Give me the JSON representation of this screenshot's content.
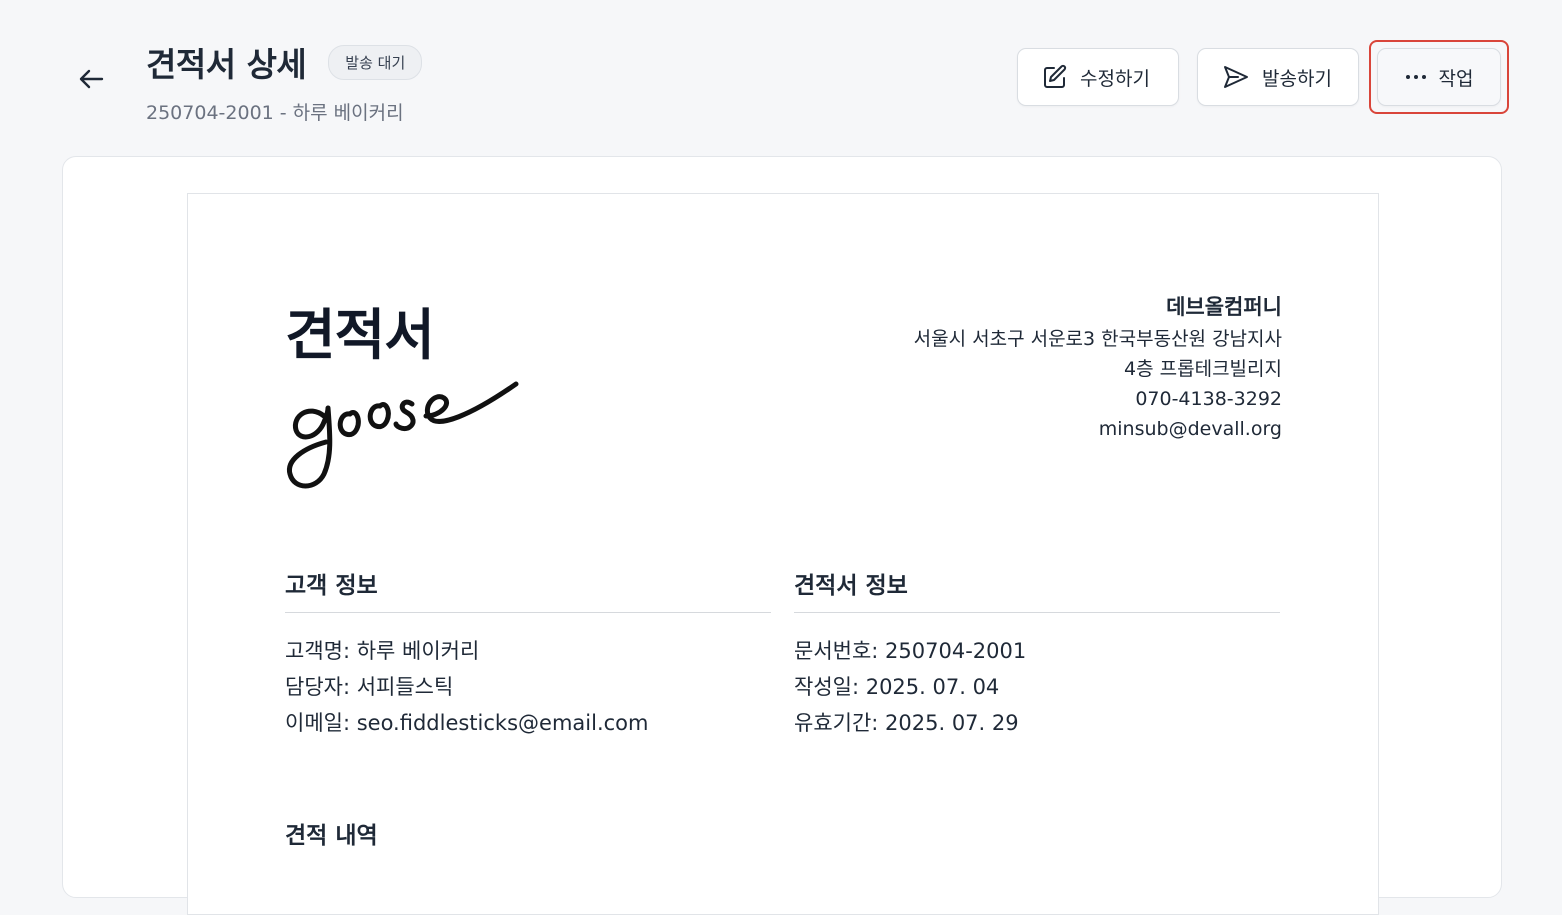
{
  "header": {
    "title": "견적서 상세",
    "status": "발송 대기",
    "subtitle": "250704-2001 - 하루 베이커리"
  },
  "actions": {
    "edit_label": "수정하기",
    "send_label": "발송하기",
    "more_label": "작업"
  },
  "document": {
    "title": "견적서",
    "company": {
      "name": "데브올컴퍼니",
      "address_line1": "서울시 서초구 서운로3 한국부동산원 강남지사",
      "address_line2": "4층 프롭테크빌리지",
      "phone": "070-4138-3292",
      "email": "minsub@devall.org"
    },
    "customer": {
      "title": "고객 정보",
      "name": "고객명: 하루 베이커리",
      "manager": "담당자: 서피들스틱",
      "email": "이메일: seo.fiddlesticks@email.com"
    },
    "quote": {
      "title": "견적서 정보",
      "number": "문서번호: 250704-2001",
      "created": "작성일: 2025. 07. 04",
      "valid": "유효기간: 2025. 07. 29"
    },
    "items_title": "견적 내역"
  },
  "colors": {
    "highlight": "#d9453a",
    "background": "#f6f7f9"
  }
}
